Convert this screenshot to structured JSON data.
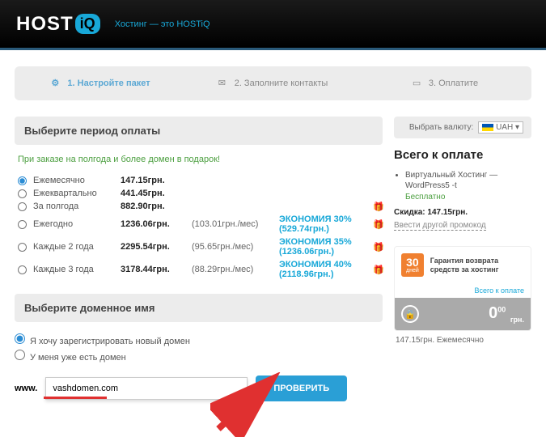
{
  "header": {
    "logo_main": "HOST",
    "logo_badge": "iQ",
    "tagline": "Хостинг — это HOSTiQ"
  },
  "steps": [
    {
      "label": "1. Настройте пакет",
      "active": true
    },
    {
      "label": "2. Заполните контакты",
      "active": false
    },
    {
      "label": "3. Оплатите",
      "active": false
    }
  ],
  "period": {
    "head": "Выберите период оплаты",
    "promo": "При заказе на полгода и более домен в подарок!",
    "rows": [
      {
        "label": "Ежемесячно",
        "price": "147.15грн.",
        "month": "",
        "econ": "",
        "gift": false,
        "checked": true
      },
      {
        "label": "Ежеквартально",
        "price": "441.45грн.",
        "month": "",
        "econ": "",
        "gift": false,
        "checked": false
      },
      {
        "label": "За полгода",
        "price": "882.90грн.",
        "month": "",
        "econ": "",
        "gift": true,
        "checked": false
      },
      {
        "label": "Ежегодно",
        "price": "1236.06грн.",
        "month": "(103.01грн./мес)",
        "econ": "ЭКОНОМИЯ 30% (529.74грн.)",
        "gift": true,
        "checked": false
      },
      {
        "label": "Каждые 2 года",
        "price": "2295.54грн.",
        "month": "(95.65грн./мес)",
        "econ": "ЭКОНОМИЯ 35% (1236.06грн.)",
        "gift": true,
        "checked": false
      },
      {
        "label": "Каждые 3 года",
        "price": "3178.44грн.",
        "month": "(88.29грн./мес)",
        "econ": "ЭКОНОМИЯ 40% (2118.96грн.)",
        "gift": true,
        "checked": false
      }
    ]
  },
  "domain": {
    "head": "Выберите доменное имя",
    "opts": [
      {
        "label": "Я хочу зарегистрировать новый домен",
        "checked": true
      },
      {
        "label": "У меня уже есть домен",
        "checked": false
      }
    ],
    "www": "www.",
    "value": "vashdomen.com",
    "check": "ПРОВЕРИТЬ"
  },
  "right": {
    "cur_label": "Выбрать валюту:",
    "cur": "UAH",
    "total_head": "Всего к оплате",
    "item": "Виртуальный Хостинг — WordPress5 -t",
    "free": "Бесплатно",
    "discount": "Скидка: 147.15грн.",
    "promo_link": "Ввести другой промокод",
    "g_days": "30",
    "g_days_l": "дней",
    "g_txt": "Гарантия возврата средств за хостинг",
    "g_link": "Всего к оплате",
    "zero_int": "0",
    "zero_dec": "00",
    "zero_cur": "грн.",
    "final": "147.15грн. Ежемесячно"
  }
}
